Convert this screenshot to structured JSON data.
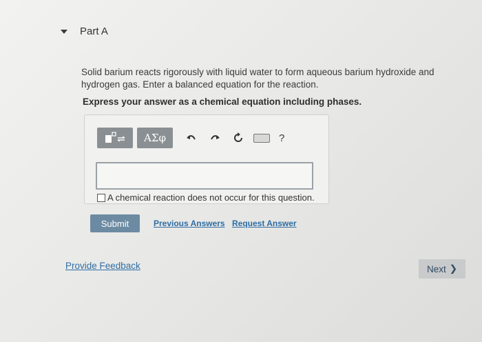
{
  "part": {
    "title": "Part A"
  },
  "question": {
    "text": "Solid barium reacts rigorously with liquid water to form aqueous barium hydroxide and hydrogen gas. Enter a balanced equation for the reaction.",
    "instruction": "Express your answer as a chemical equation including phases."
  },
  "toolbar": {
    "symbols_label": "ΑΣφ",
    "help_label": "?"
  },
  "answer": {
    "value": "",
    "placeholder": ""
  },
  "no_reaction": {
    "label": "A chemical reaction does not occur for this question."
  },
  "actions": {
    "submit": "Submit",
    "previous_answers": "Previous Answers",
    "request_answer": "Request Answer"
  },
  "footer": {
    "feedback": "Provide Feedback",
    "next": "Next",
    "next_chevron": "❯"
  }
}
